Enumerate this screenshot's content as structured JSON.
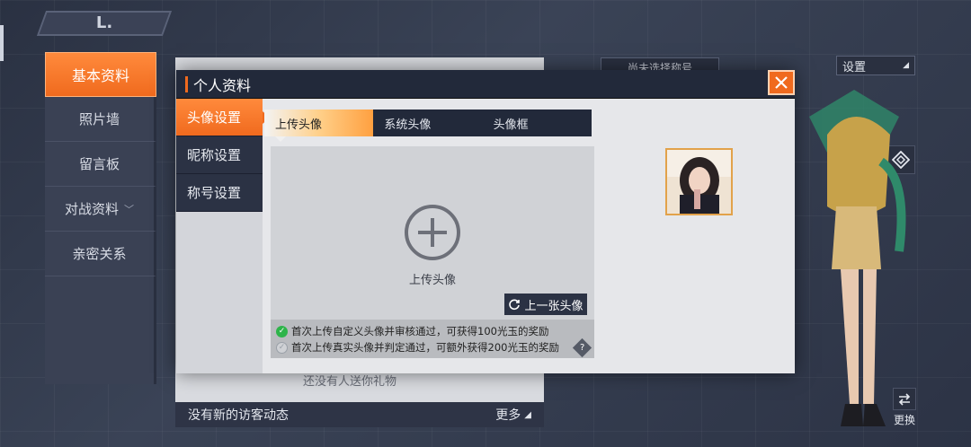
{
  "back": {
    "label": "L."
  },
  "sidebar": {
    "items": [
      {
        "label": "基本资料",
        "active": true
      },
      {
        "label": "照片墙"
      },
      {
        "label": "留言板"
      },
      {
        "label": "对战资料",
        "has_chevron": true
      },
      {
        "label": "亲密关系"
      }
    ]
  },
  "under": {
    "gift_text": "还没有人送你礼物",
    "visitor_text": "没有新的访客动态",
    "more_label": "更多"
  },
  "top_right": {
    "title_select": "尚未选择称号",
    "settings_label": "设置",
    "swap_label": "更换"
  },
  "modal": {
    "title": "个人资料",
    "tabs": [
      {
        "label": "头像设置",
        "active": true
      },
      {
        "label": "昵称设置"
      },
      {
        "label": "称号设置"
      }
    ],
    "sub_tabs": [
      {
        "label": "上传头像",
        "active": true
      },
      {
        "label": "系统头像"
      },
      {
        "label": "头像框"
      }
    ],
    "upload_label": "上传头像",
    "prev_button": "上一张头像",
    "notes": [
      {
        "text": "首次上传自定义头像并审核通过，可获得100光玉的奖励",
        "done": true
      },
      {
        "text": "首次上传真实头像并判定通过，可额外获得200光玉的奖励",
        "done": false
      }
    ]
  },
  "colors": {
    "accent": "#f06a1e",
    "dark": "#22293a",
    "success": "#2eb44a"
  }
}
